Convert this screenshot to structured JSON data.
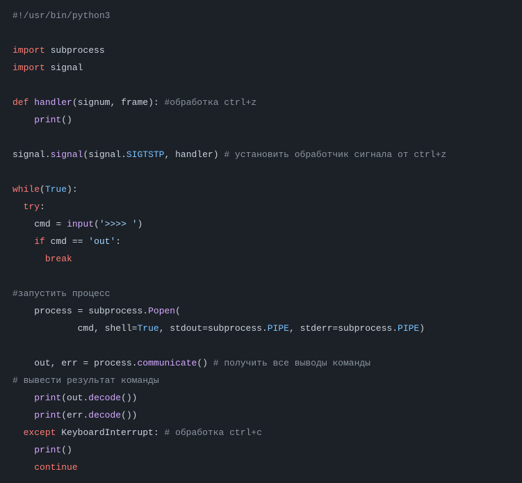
{
  "code": {
    "shebang": "#!/usr/bin/python3",
    "import_kw": "import",
    "mod_subprocess": "subprocess",
    "mod_signal": "signal",
    "def_kw": "def",
    "handler_name": "handler",
    "param_signum": "signum",
    "param_frame": "frame",
    "cm_handler": "#обработка ctrl+z",
    "print_name": "print",
    "signal_id": "signal",
    "signal_fn": "signal",
    "sigtstp": "SIGTSTP",
    "handler_ref": "handler",
    "cm_setsig": "# установить обработчик сигнала от ctrl+z",
    "while_kw": "while",
    "true_const": "True",
    "try_kw": "try",
    "cmd_id": "cmd",
    "eq": "=",
    "input_fn": "input",
    "prompt_str": "'>>>> '",
    "if_kw": "if",
    "eqeq": "==",
    "out_str": "'out'",
    "break_kw": "break",
    "cm_launch": "#запустить процесс",
    "process_id": "process",
    "popen_fn": "Popen",
    "cmd_arg": "cmd",
    "shell_kw": "shell",
    "stdout_kw": "stdout",
    "pipe_const": "PIPE",
    "stderr_kw": "stderr",
    "out_id": "out",
    "err_id": "err",
    "communicate_fn": "communicate",
    "cm_getout": "# получить все выводы команды",
    "cm_result": "# вывести результат команды",
    "decode_fn": "decode",
    "except_kw": "except",
    "kbint": "KeyboardInterrupt",
    "cm_ctrlc": "# обработка ctrl+c",
    "continue_kw": "continue"
  }
}
